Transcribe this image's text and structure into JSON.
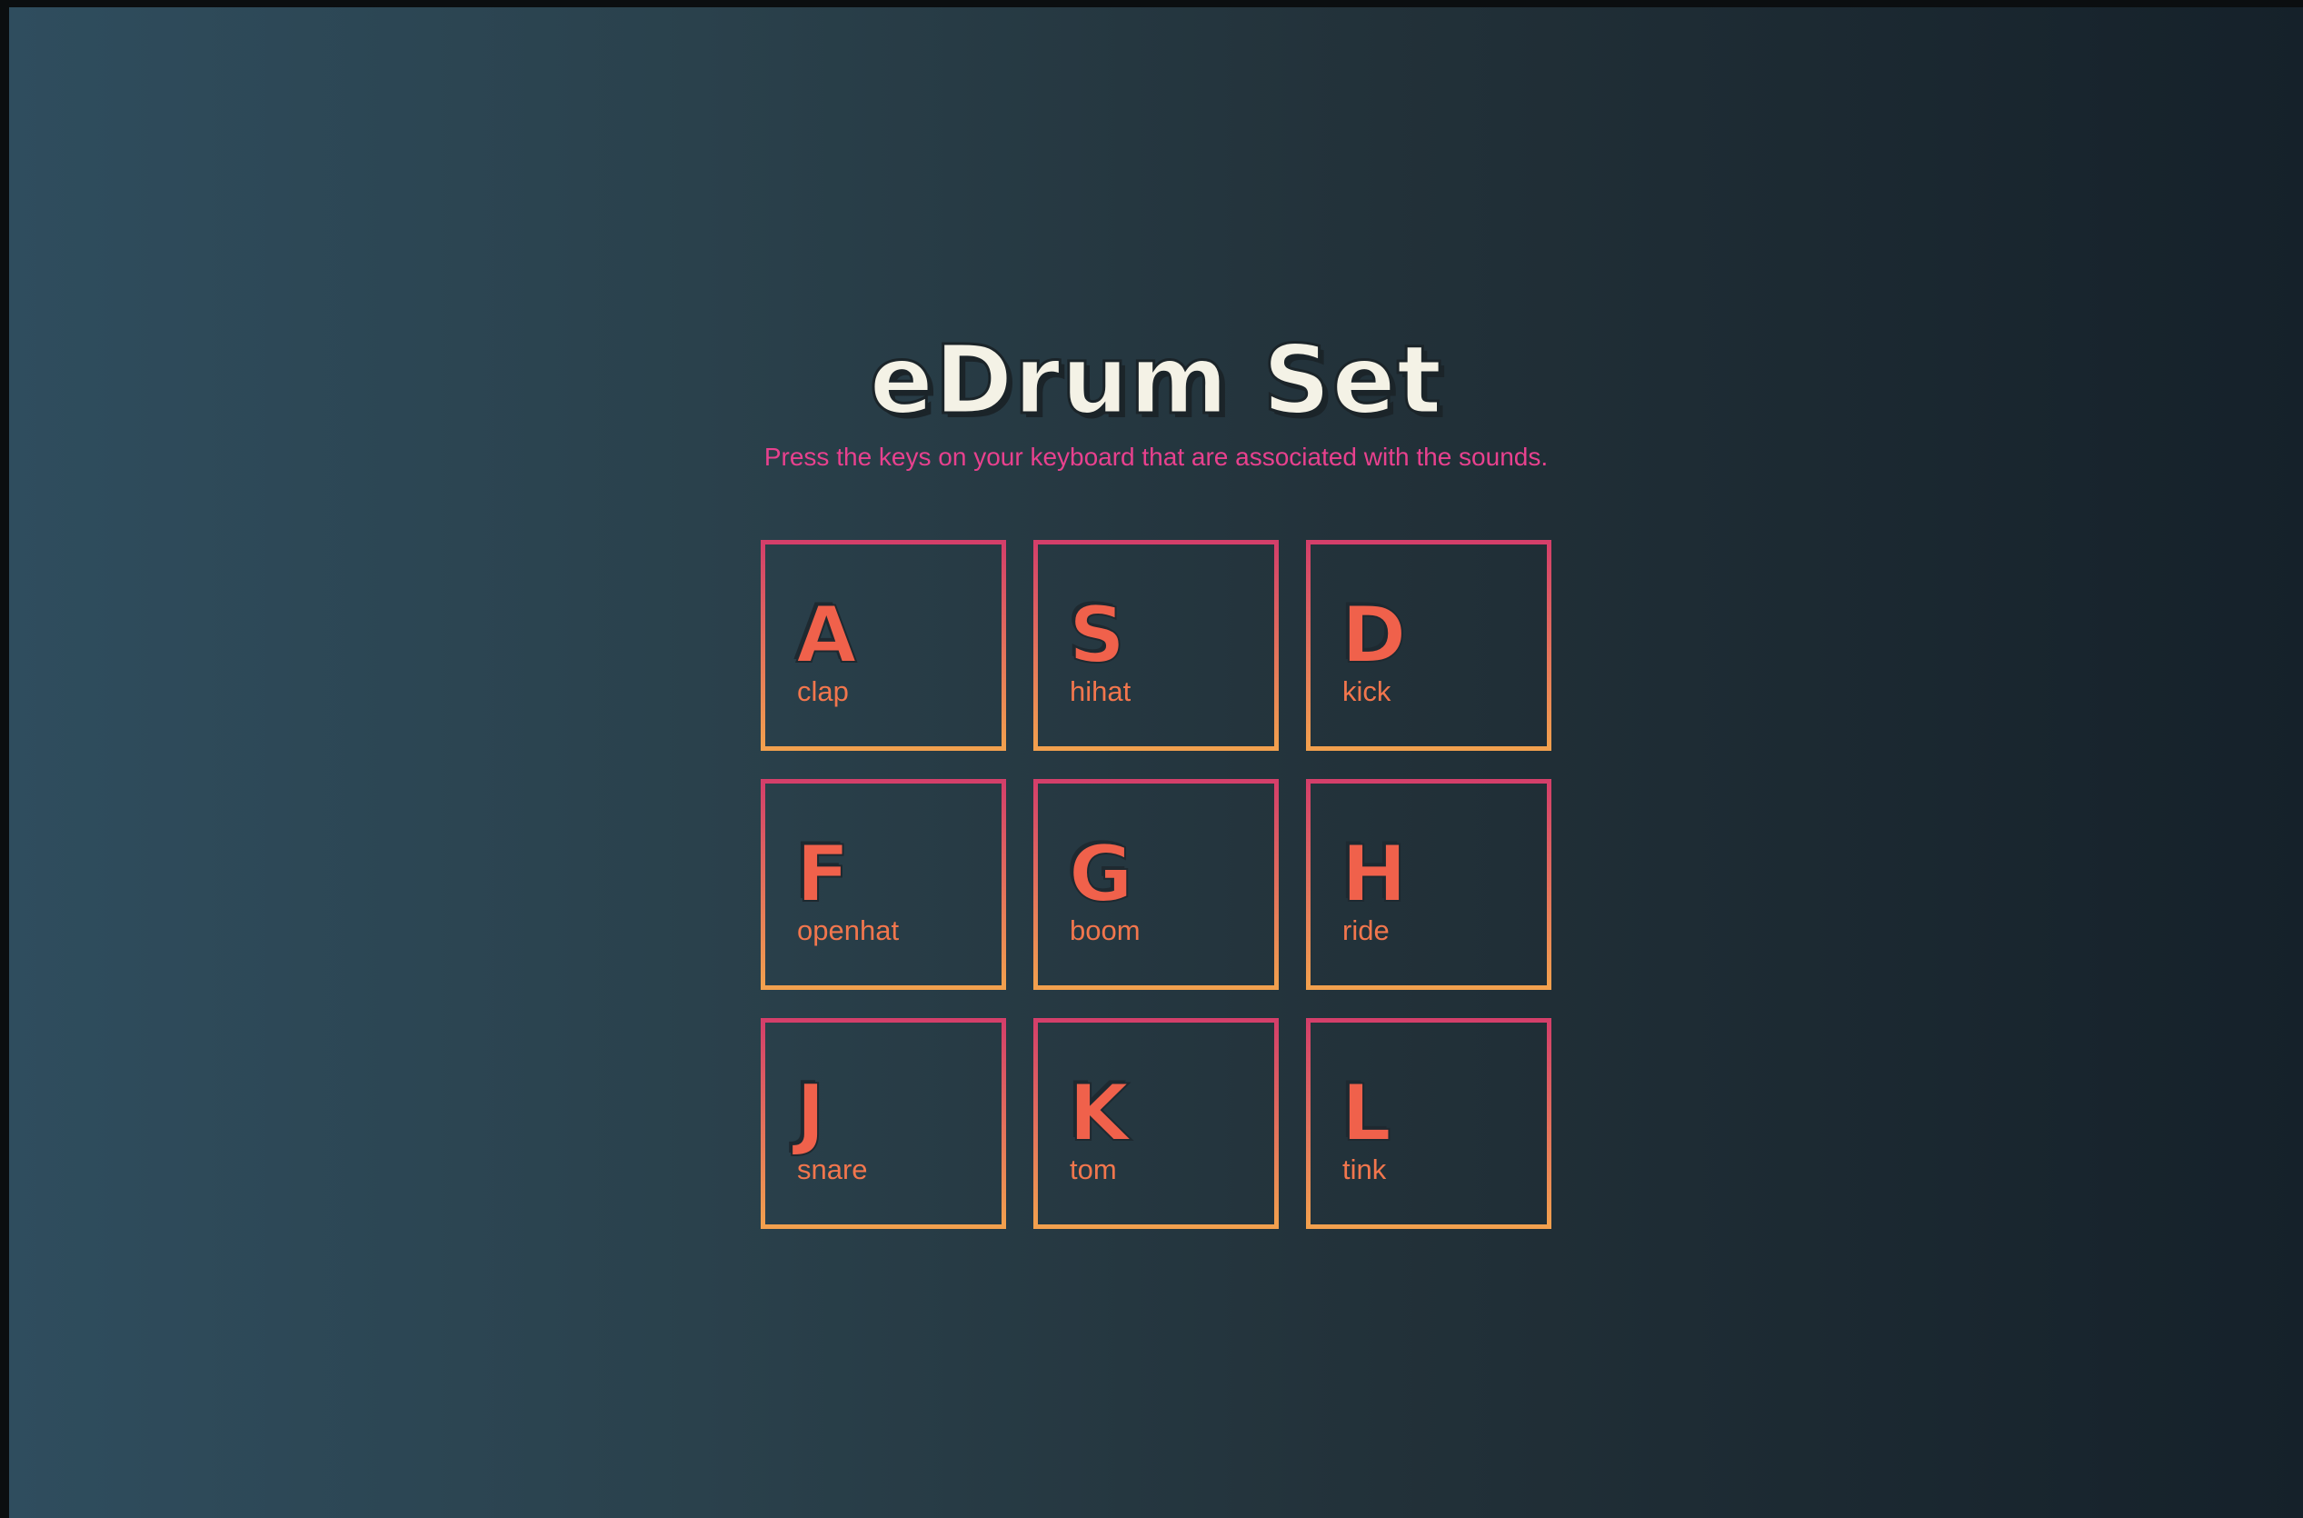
{
  "header": {
    "title": "eDrum Set",
    "subtitle": "Press the keys on your keyboard that are associated with the sounds."
  },
  "keys": [
    {
      "letter": "A",
      "sound": "clap"
    },
    {
      "letter": "S",
      "sound": "hihat"
    },
    {
      "letter": "D",
      "sound": "kick"
    },
    {
      "letter": "F",
      "sound": "openhat"
    },
    {
      "letter": "G",
      "sound": "boom"
    },
    {
      "letter": "H",
      "sound": "ride"
    },
    {
      "letter": "J",
      "sound": "snare"
    },
    {
      "letter": "K",
      "sound": "tom"
    },
    {
      "letter": "L",
      "sound": "tink"
    }
  ],
  "colors": {
    "title": "#f4f2e6",
    "subtitle": "#e8418e",
    "key_border_top": "#d43f6a",
    "key_border_bottom": "#f2a04e",
    "key_text": "#f0614b"
  }
}
